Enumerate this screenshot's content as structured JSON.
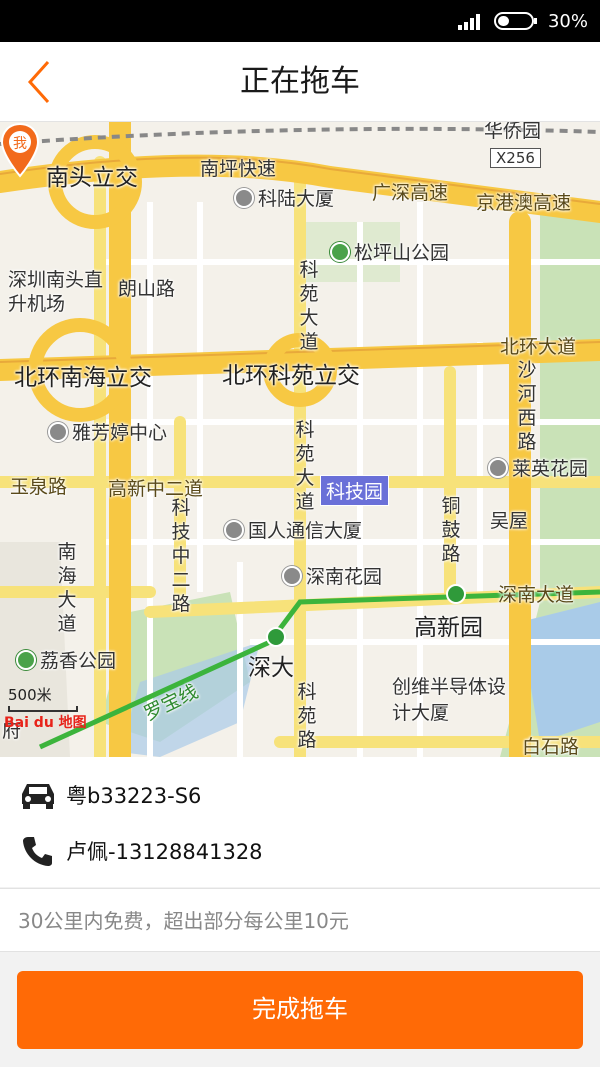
{
  "status_bar": {
    "battery_percent": "30%"
  },
  "header": {
    "title": "正在拖车"
  },
  "map": {
    "labels": {
      "nantou_interchange": "南头立交",
      "nanping_expressway": "南坪快速",
      "kelu_building": "科陆大厦",
      "guangshen_expressway": "广深高速",
      "jinggangao_expressway": "京港澳高速",
      "x256": "X256",
      "pinghu_park_top": "华侨园",
      "songpingshan_park": "松坪山公园",
      "shenzhen_nantou_heliport": "深圳南头直升机场",
      "langshan_road": "朗山路",
      "keyuan_avenue_n": "科苑大道",
      "beihuan_nanhai_interchange": "北环南海立交",
      "beihuan_keyuan_interchange": "北环科苑立交",
      "beihuan_avenue": "北环大道",
      "shahe_west_road": "沙河西路",
      "yafangting_center": "雅芳婷中心",
      "keyuan_avenue_mid": "科苑大道",
      "laiying_garden": "莱英花园",
      "yuquan_road": "玉泉路",
      "gaoxin_zhong_2_road": "高新中二道",
      "keji_yuan": "科技园",
      "keji_zhong_2_road": "科技中二路",
      "guoren_tongxin_building": "国人通信大厦",
      "tonggu_road": "铜鼓路",
      "wuwu": "吴屋",
      "nanhai_avenue": "南海大道",
      "shennan_garden": "深南花园",
      "shennan_avenue": "深南大道",
      "gaoxin_yuan": "高新园",
      "lixiang_park": "荔香公园",
      "shen_da": "深大",
      "keyuan_road_s": "科苑路",
      "chuangwei_semiconductor": "创维半导体设计大厦",
      "luobao_line": "罗宝线",
      "baishi_road": "白石路",
      "fu": "府",
      "scale": "500米",
      "baidu": "Bai du 地图",
      "pin_label": "我"
    }
  },
  "vehicle": {
    "plate": "粤b33223-S6"
  },
  "driver": {
    "contact": "卢佩-13128841328"
  },
  "fee_note": "30公里内免费，超出部分每公里10元",
  "action_button": {
    "label": "完成拖车"
  },
  "colors": {
    "accent": "#ff6a06",
    "pin": "#f26a1b",
    "metro_line": "#3cb43c",
    "highway": "#f7c843"
  },
  "icons": {
    "back": "chevron-left-icon",
    "car": "car-icon",
    "phone": "phone-icon",
    "signal": "signal-icon",
    "battery": "battery-icon",
    "pin": "location-pin-icon"
  }
}
